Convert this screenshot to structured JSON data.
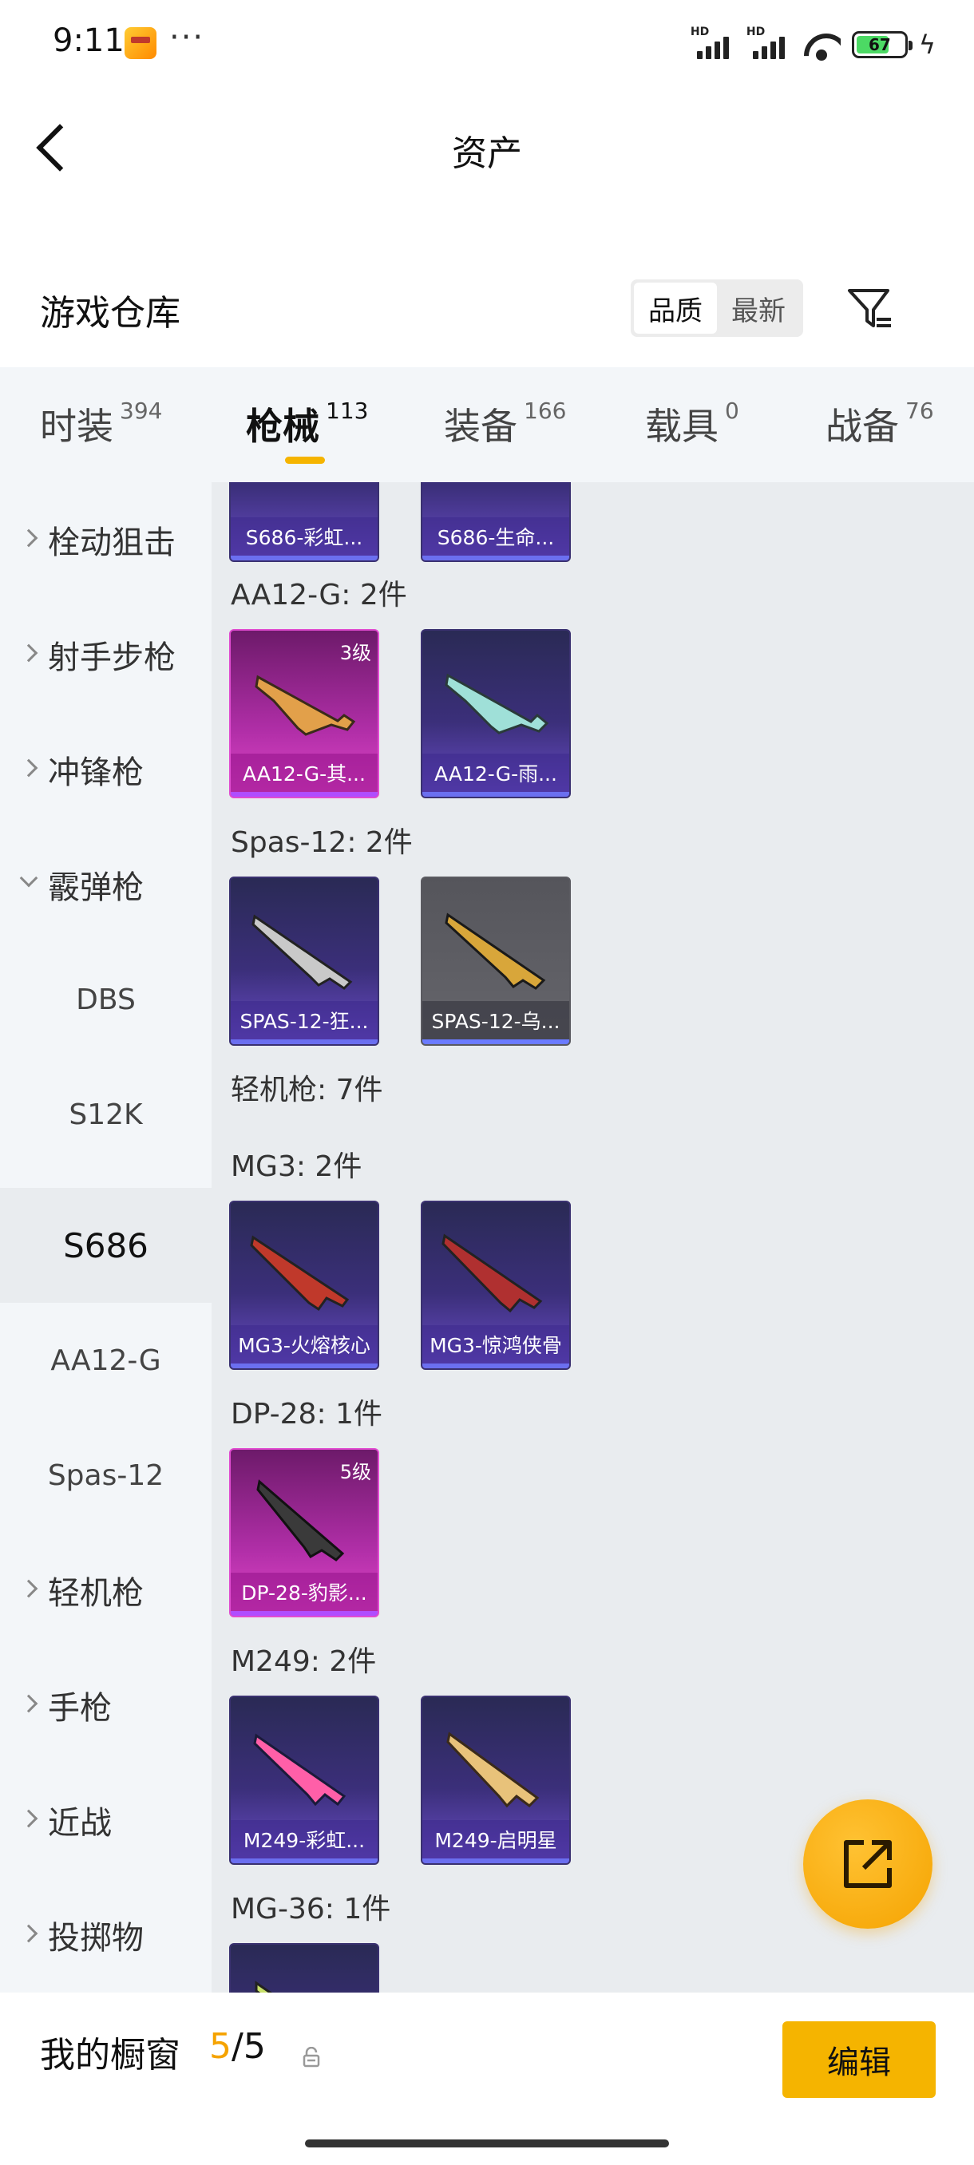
{
  "status_bar": {
    "time": "9:11",
    "more_indicator": "···",
    "battery_level": "67",
    "network_labels": [
      "HD",
      "HD"
    ]
  },
  "header": {
    "title": "资产"
  },
  "warehouse": {
    "title": "游戏仓库",
    "sort_options": [
      "品质",
      "最新"
    ],
    "active_sort": "品质"
  },
  "category_tabs": [
    {
      "label": "时装",
      "count": "394"
    },
    {
      "label": "枪械",
      "count": "113",
      "active": true
    },
    {
      "label": "装备",
      "count": "166"
    },
    {
      "label": "载具",
      "count": "0"
    },
    {
      "label": "战备",
      "count": "76"
    }
  ],
  "sidebar": {
    "items": [
      {
        "label": "栓动狙击",
        "type": "collapsed"
      },
      {
        "label": "射手步枪",
        "type": "collapsed"
      },
      {
        "label": "冲锋枪",
        "type": "collapsed"
      },
      {
        "label": "霰弹枪",
        "type": "expanded"
      },
      {
        "label": "DBS",
        "type": "sub"
      },
      {
        "label": "S12K",
        "type": "sub"
      },
      {
        "label": "S686",
        "type": "sub",
        "selected": true
      },
      {
        "label": "AA12-G",
        "type": "sub"
      },
      {
        "label": "Spas-12",
        "type": "sub"
      },
      {
        "label": "轻机枪",
        "type": "collapsed"
      },
      {
        "label": "手枪",
        "type": "collapsed"
      },
      {
        "label": "近战",
        "type": "collapsed"
      },
      {
        "label": "投掷物",
        "type": "collapsed"
      }
    ]
  },
  "content": {
    "top_partial_cards": [
      {
        "name": "S686-彩虹...",
        "rarity": "purple"
      },
      {
        "name": "S686-生命...",
        "rarity": "purple"
      }
    ],
    "groups": [
      {
        "label": "AA12-G: 2件",
        "items": [
          {
            "name": "AA12-G-其...",
            "rarity": "pink",
            "level": "3级",
            "accent": "#e2a04a"
          },
          {
            "name": "AA12-G-雨...",
            "rarity": "purple",
            "accent": "#9fe0d8"
          }
        ]
      },
      {
        "label": "Spas-12: 2件",
        "items": [
          {
            "name": "SPAS-12-狂...",
            "rarity": "purple",
            "accent": "#c9c9c9"
          },
          {
            "name": "SPAS-12-乌...",
            "rarity": "gray",
            "accent": "#d8a63a"
          }
        ]
      },
      {
        "label": "轻机枪: 7件",
        "items": []
      },
      {
        "label": "MG3: 2件",
        "items": [
          {
            "name": "MG3-火熔核心",
            "rarity": "purple",
            "accent": "#c0392b"
          },
          {
            "name": "MG3-惊鸿侠骨",
            "rarity": "purple",
            "accent": "#b03030"
          }
        ]
      },
      {
        "label": "DP-28: 1件",
        "items": [
          {
            "name": "DP-28-豹影...",
            "rarity": "pink",
            "level": "5级",
            "accent": "#3a3a3a"
          }
        ]
      },
      {
        "label": "M249: 2件",
        "items": [
          {
            "name": "M249-彩虹...",
            "rarity": "purple",
            "accent": "#ff5fa8"
          },
          {
            "name": "M249-启明星",
            "rarity": "purple",
            "accent": "#e8c27a"
          }
        ]
      },
      {
        "label": "MG-36: 1件",
        "items": []
      }
    ]
  },
  "bottom_bar": {
    "window_label": "我的橱窗",
    "window_current": "5",
    "window_total": "/5",
    "edit_label": "编辑"
  },
  "colors": {
    "accent": "#f5b400",
    "rarity_purple": "#3b2f7a",
    "rarity_pink": "#b02ea7",
    "rarity_gray": "#5a5a60"
  },
  "icons": {
    "back": "chevron-left-icon",
    "filter": "filter-list-icon",
    "share": "external-link-icon",
    "lock": "lock-icon"
  }
}
